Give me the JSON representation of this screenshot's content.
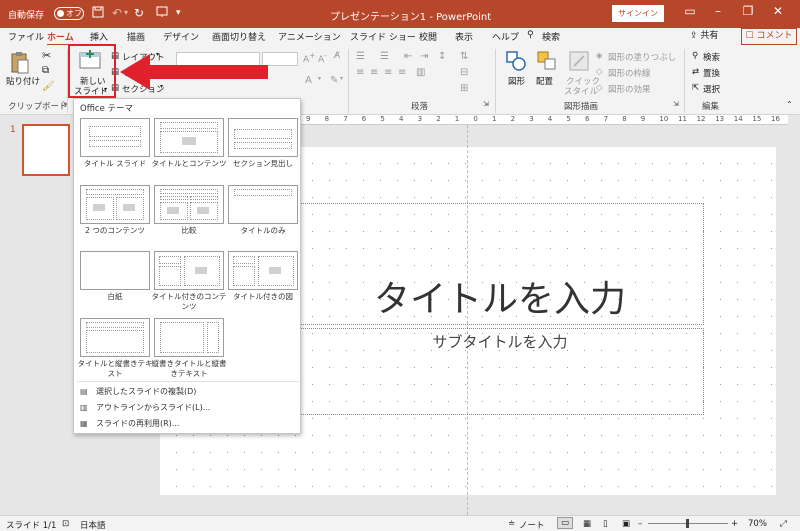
{
  "titlebar": {
    "autosave_label": "自動保存",
    "autosave_state": "オフ",
    "doc_title": "プレゼンテーション1 - PowerPoint",
    "signin_label": "サインイン",
    "accent": "#b7472a"
  },
  "tabs": [
    {
      "label": "ファイル"
    },
    {
      "label": "ホーム"
    },
    {
      "label": "挿入"
    },
    {
      "label": "描画"
    },
    {
      "label": "デザイン"
    },
    {
      "label": "画面切り替え"
    },
    {
      "label": "アニメーション"
    },
    {
      "label": "スライド ショー"
    },
    {
      "label": "校閲"
    },
    {
      "label": "表示"
    },
    {
      "label": "ヘルプ"
    },
    {
      "label": "検索"
    }
  ],
  "share_label": "共有",
  "comment_label": "コメント",
  "ribbon": {
    "paste_label": "貼り付け",
    "clipboard_group": "クリップボード",
    "new_slide_line1": "新しい",
    "new_slide_line2": "スライド",
    "layout_label": "レイアウト",
    "reset_label": "リ",
    "section_label": "セクション",
    "paragraph_group": "段落",
    "shape_label": "図形",
    "arrange_label": "配置",
    "quick_style_line1": "クイック",
    "quick_style_line2": "スタイル",
    "shape_fill": "図形の塗りつぶし",
    "shape_outline": "図形の枠線",
    "shape_effects": "図形の効果",
    "drawing_group": "図形描画",
    "find_label": "検索",
    "replace_label": "置換",
    "select_label": "選択",
    "editing_group": "編集"
  },
  "slide_pane": {
    "slide_number": "1"
  },
  "ruler_ticks": [
    "9",
    "8",
    "7",
    "6",
    "5",
    "4",
    "3",
    "2",
    "1",
    "0",
    "1",
    "2",
    "3",
    "4",
    "5",
    "6",
    "7",
    "8",
    "9",
    "10",
    "11",
    "12",
    "13",
    "14",
    "15",
    "16"
  ],
  "slide": {
    "title_placeholder": "タイトルを入力",
    "subtitle_placeholder": "サブタイトルを入力"
  },
  "gallery": {
    "header": "Office テーマ",
    "layouts": [
      {
        "label": "タイトル スライド"
      },
      {
        "label": "タイトルとコンテンツ"
      },
      {
        "label": "セクション見出し"
      },
      {
        "label": "2 つのコンテンツ"
      },
      {
        "label": "比較"
      },
      {
        "label": "タイトルのみ"
      },
      {
        "label": "白紙"
      },
      {
        "label": "タイトル付きのコンテンツ"
      },
      {
        "label": "タイトル付きの図"
      },
      {
        "label": "タイトルと縦書きテキスト"
      },
      {
        "label": "縦書きタイトルと縦書きテキスト"
      }
    ],
    "menu": [
      {
        "label": "選択したスライドの複製(D)"
      },
      {
        "label": "アウトラインからスライド(L)..."
      },
      {
        "label": "スライドの再利用(R)..."
      }
    ]
  },
  "status": {
    "slide_count": "スライド 1/1",
    "language": "日本語",
    "notes_label": "ノート",
    "zoom": "70%"
  }
}
